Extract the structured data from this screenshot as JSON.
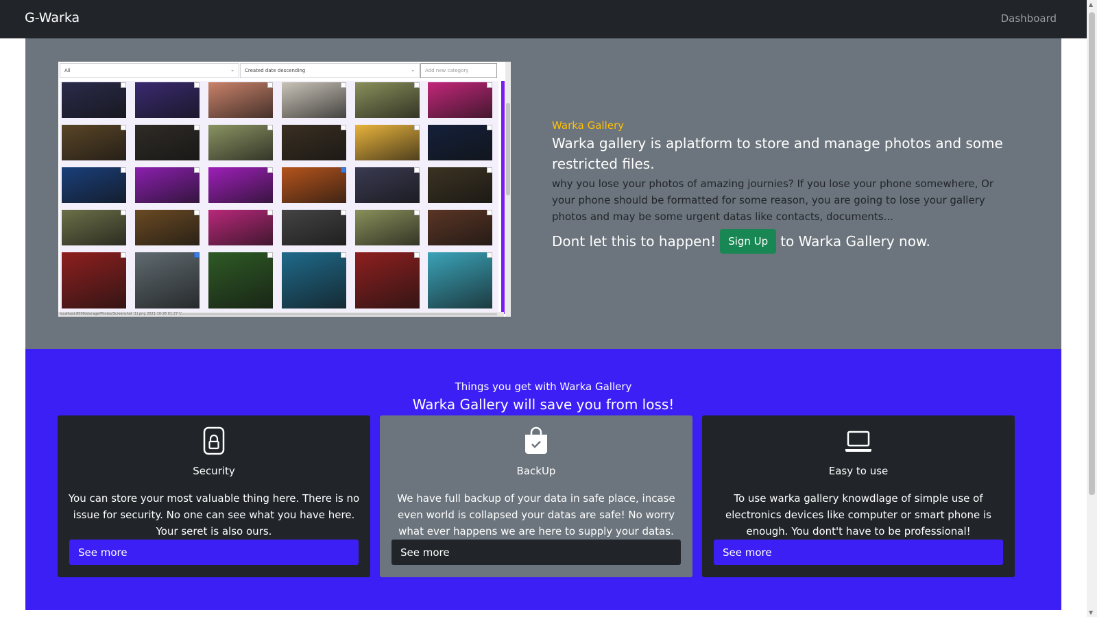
{
  "navbar": {
    "brand": "G-Warka",
    "dashboard_link": "Dashboard"
  },
  "hero": {
    "screenshot": {
      "filter_select": "All",
      "sort_select": "Created date descending",
      "category_placeholder": "Add new category",
      "status_path": "localhost:8000/storage/Photos/Screenshot (1).png 2021-10-26 01:27-15.jpeg",
      "thumb_colors": [
        [
          "#2a2b4a",
          "#3a2a70",
          "#c9826a",
          "#c9c3b8",
          "#8a8f5a",
          "#c2277a"
        ],
        [
          "#5a4527",
          "#2f2b26",
          "#8a9362",
          "#3a2f22",
          "#e8b33c",
          "#14203a"
        ],
        [
          "#1a3f7a",
          "#8b1fae",
          "#9d1fb8",
          "#b5541c",
          "#3a3a52",
          "#3b3222"
        ],
        [
          "#6c7048",
          "#6a4a23",
          "#b8287a",
          "#444444",
          "#8a8f5a",
          "#5a3525"
        ],
        [
          "#8e1f1f",
          "#5f6a70",
          "#2e5a25",
          "#1f6a8a",
          "#8e1f1f",
          "#3aa3b8"
        ]
      ],
      "checked": [
        [],
        [],
        [
          3
        ],
        [],
        [
          1
        ]
      ]
    },
    "kicker": "Warka Gallery",
    "lead": "Warka gallery is aplatform to store and manage photos and some restricted files.",
    "paragraph": "why you lose your photos of amazing journies? If you lose your phone somewhere, Or your phone should be formatted for some reason, you are going to lose your gallery photos and may be some urgent datas like contacts, documents...",
    "cta_before": "Dont let this to happen!",
    "signup_label": "Sign Up",
    "cta_after": "to Warka Gallery now."
  },
  "features": {
    "subtitle": "Things you get with Warka Gallery",
    "title": "Warka Gallery will save you from loss!",
    "cards": [
      {
        "icon": "lock-icon",
        "title": "Security",
        "text": "You can store your most valuable thing here. There is no issue for security. No one can see what you have here. Your seret is also ours.",
        "button": "See more"
      },
      {
        "icon": "bag-check-icon",
        "title": "BackUp",
        "text": "We have full backup of your data in safe place, incase even world is collapsed your datas are safe! No worry what ever happens we are here to supply your datas.",
        "button": "See more"
      },
      {
        "icon": "laptop-icon",
        "title": "Easy to use",
        "text": "To use warka gallery knowdlage of simple use of electronics devices like computer or smart phone is enough. You dont't have to be professional!",
        "button": "See more"
      }
    ]
  },
  "colors": {
    "navbar": "#212529",
    "hero_bg": "#6c757d",
    "accent": "#ffc107",
    "signup": "#198754",
    "features_bg": "#3b1ff5"
  }
}
